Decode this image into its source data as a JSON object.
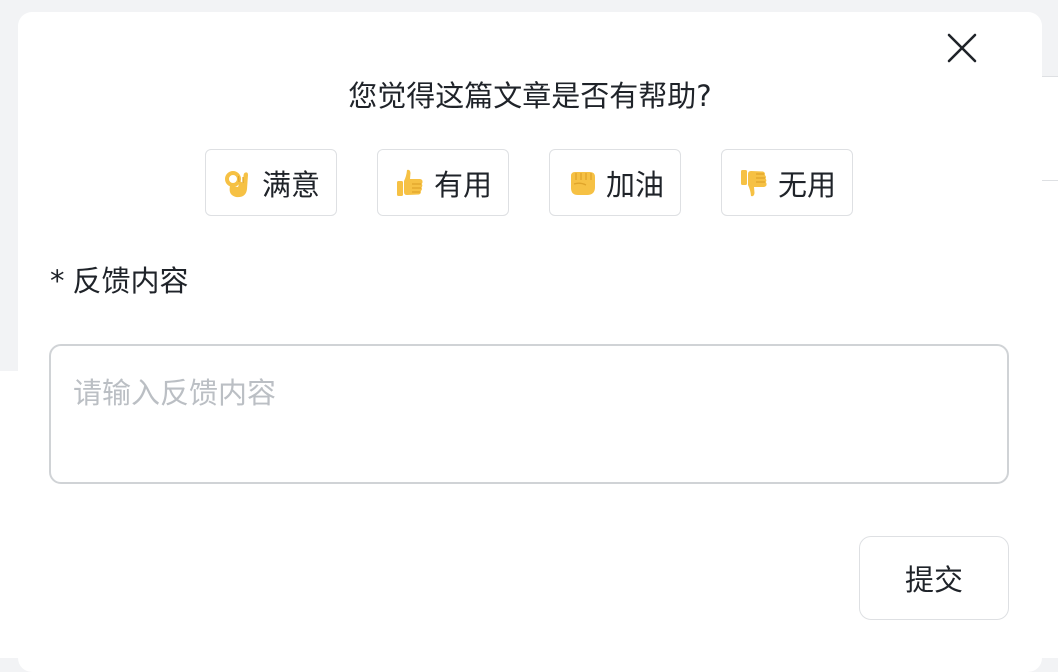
{
  "dialog": {
    "question": "您觉得这篇文章是否有帮助?",
    "close_icon": "close-icon",
    "choices": [
      {
        "icon": "ok-hand-icon",
        "label": "满意"
      },
      {
        "icon": "thumbs-up-icon",
        "label": "有用"
      },
      {
        "icon": "fist-icon",
        "label": "加油"
      },
      {
        "icon": "thumbs-down-icon",
        "label": "无用"
      }
    ],
    "feedback": {
      "required_mark": "*",
      "label": "反馈内容",
      "placeholder": "请输入反馈内容",
      "value": ""
    },
    "submit_label": "提交"
  },
  "colors": {
    "text": "#1f2329",
    "border": "#dee0e3",
    "placeholder": "#bbbfc4",
    "emoji": "#f6c144"
  }
}
